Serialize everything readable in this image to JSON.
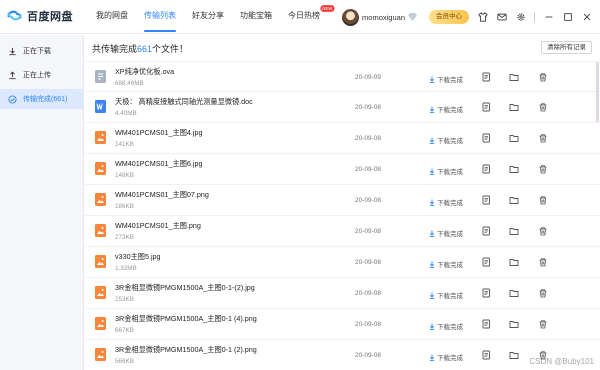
{
  "app": {
    "logo_text": "百度网盘"
  },
  "nav": {
    "items": [
      {
        "label": "我的网盘"
      },
      {
        "label": "传输列表"
      },
      {
        "label": "好友分享"
      },
      {
        "label": "功能宝箱"
      },
      {
        "label": "今日热榜",
        "badge": "NEW"
      }
    ],
    "active_index": 1
  },
  "user": {
    "name": "momoxiguan",
    "member_button": "会员中心"
  },
  "sidebar": {
    "items": [
      {
        "label": "正在下载",
        "icon": "download-icon"
      },
      {
        "label": "正在上传",
        "icon": "upload-icon"
      },
      {
        "label": "传输完成(661)",
        "icon": "check-circle-icon"
      }
    ],
    "active_index": 2
  },
  "summary": {
    "prefix": "共传输完成",
    "count": "661",
    "suffix": "个文件！"
  },
  "clear_button": "清除所有记录",
  "files": [
    {
      "name": "XP纯净优化板.ova",
      "size": "688.46MB",
      "date": "20-09-09",
      "status": "下载完成",
      "type": "ova"
    },
    {
      "name": "天极：  高精度接触式同轴光测量显微镜.doc",
      "size": "4.40MB",
      "date": "20-09-08",
      "status": "下载完成",
      "type": "doc"
    },
    {
      "name": "WM401PCMS01_主图4.jpg",
      "size": "141KB",
      "date": "20-09-08",
      "status": "下载完成",
      "type": "img"
    },
    {
      "name": "WM401PCMS01_主图6.jpg",
      "size": "148KB",
      "date": "20-09-08",
      "status": "下载完成",
      "type": "img"
    },
    {
      "name": "WM401PCMS01_主图07.png",
      "size": "186KB",
      "date": "20-09-08",
      "status": "下载完成",
      "type": "img"
    },
    {
      "name": "WM401PCMS01_主图.png",
      "size": "273KB",
      "date": "20-09-08",
      "status": "下载完成",
      "type": "img"
    },
    {
      "name": "v330主图5.jpg",
      "size": "1.32MB",
      "date": "20-09-08",
      "status": "下载完成",
      "type": "img"
    },
    {
      "name": "3R金相显微镜PMGM1500A_主图0-1-(2).jpg",
      "size": "253KB",
      "date": "20-09-08",
      "status": "下载完成",
      "type": "img"
    },
    {
      "name": "3R金相显微镜PMGM1500A_主图0-1 (4).png",
      "size": "667KB",
      "date": "20-09-08",
      "status": "下载完成",
      "type": "img"
    },
    {
      "name": "3R金相显微镜PMGM1500A_主图0-1 (2).png",
      "size": "566KB",
      "date": "20-09-08",
      "status": "下载完成",
      "type": "img"
    }
  ],
  "watermark": "CSDN @Buby101",
  "colors": {
    "accent": "#2f86f6",
    "image_icon": "#f7853a",
    "doc_icon": "#3b82f6",
    "ova_icon": "#a9b4c2"
  }
}
